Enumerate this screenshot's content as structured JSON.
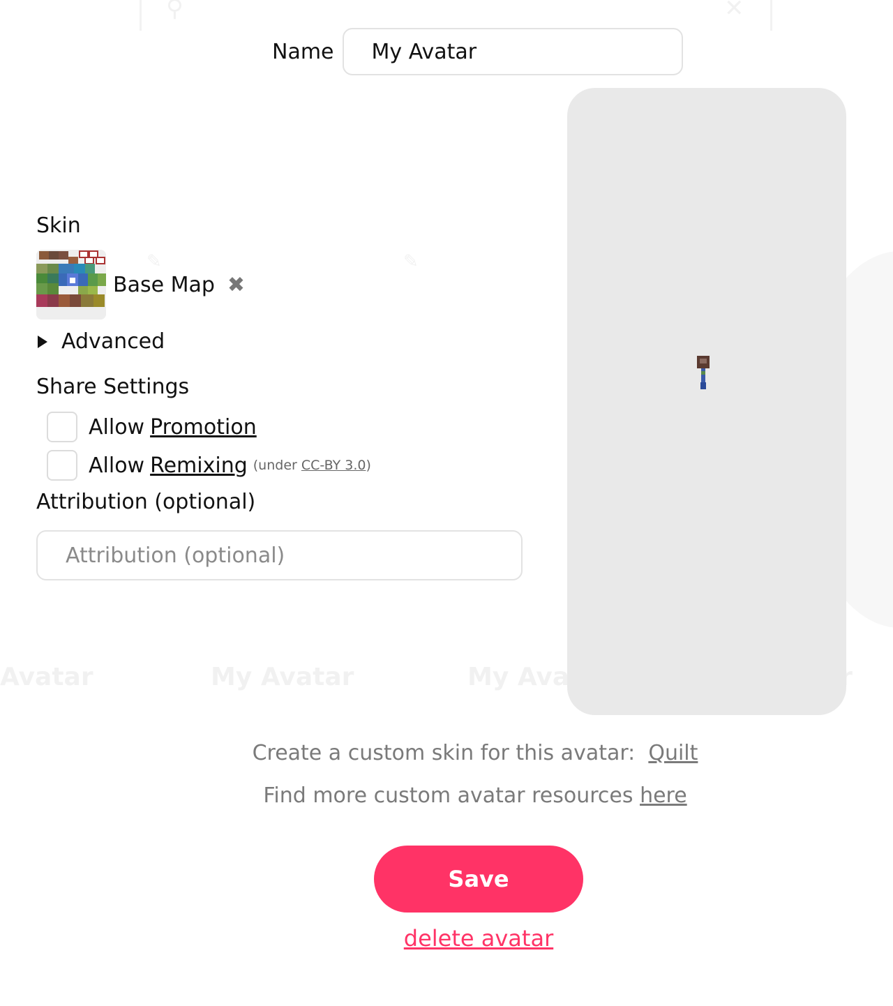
{
  "background": {
    "ghost_labels": [
      "Avatar",
      "My Avatar",
      "My Avat",
      "ar"
    ]
  },
  "name_field": {
    "label": "Name",
    "value": "My Avatar"
  },
  "skin": {
    "heading": "Skin",
    "selected_name": "Base Map",
    "remove_glyph": "✖",
    "remove_icon": "close-icon"
  },
  "advanced": {
    "label": "Advanced",
    "icon": "triangle-right-icon",
    "expanded": false
  },
  "share_settings": {
    "heading": "Share Settings",
    "allow_promotion": {
      "prefix": "Allow",
      "link": "Promotion",
      "checked": false
    },
    "allow_remixing": {
      "prefix": "Allow",
      "link": "Remixing",
      "note_open": "(under",
      "note_link": "CC-BY 3.0",
      "note_close": ")",
      "checked": false
    }
  },
  "attribution": {
    "heading": "Attribution (optional)",
    "placeholder": "Attribution (optional)",
    "value": ""
  },
  "helpers": {
    "custom_skin_text": "Create a custom skin for this avatar:",
    "custom_skin_link": "Quilt",
    "resources_text": "Find more custom avatar resources",
    "resources_link": "here"
  },
  "actions": {
    "save_label": "Save",
    "delete_label": "delete avatar"
  },
  "colors": {
    "accent": "#ff3366",
    "preview_bg": "#e9e9e9",
    "helper_text": "#7a7a7a"
  }
}
